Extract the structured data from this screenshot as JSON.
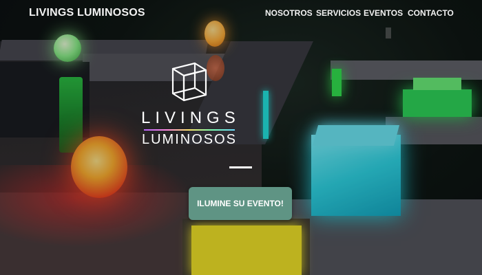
{
  "nav": {
    "brand": "LIVINGS LUMINOSOS",
    "items": [
      {
        "label": "NOSOTROS"
      },
      {
        "label": "SERVICIOS"
      },
      {
        "label": "EVENTOS"
      },
      {
        "label": "CONTACTO"
      }
    ]
  },
  "logo": {
    "icon": "cube-outline-icon",
    "line1": "LIVINGS",
    "line2": "LUMINOSOS"
  },
  "hero": {
    "cta_label": "ILUMINE SU EVENTO!"
  },
  "colors": {
    "cta_background": "#5f9484",
    "nav_text": "#f2f2f2",
    "logo_gradient": [
      "#b866ff",
      "#ff8ae0",
      "#ffe96a",
      "#7affb0",
      "#6cd9ff"
    ]
  }
}
